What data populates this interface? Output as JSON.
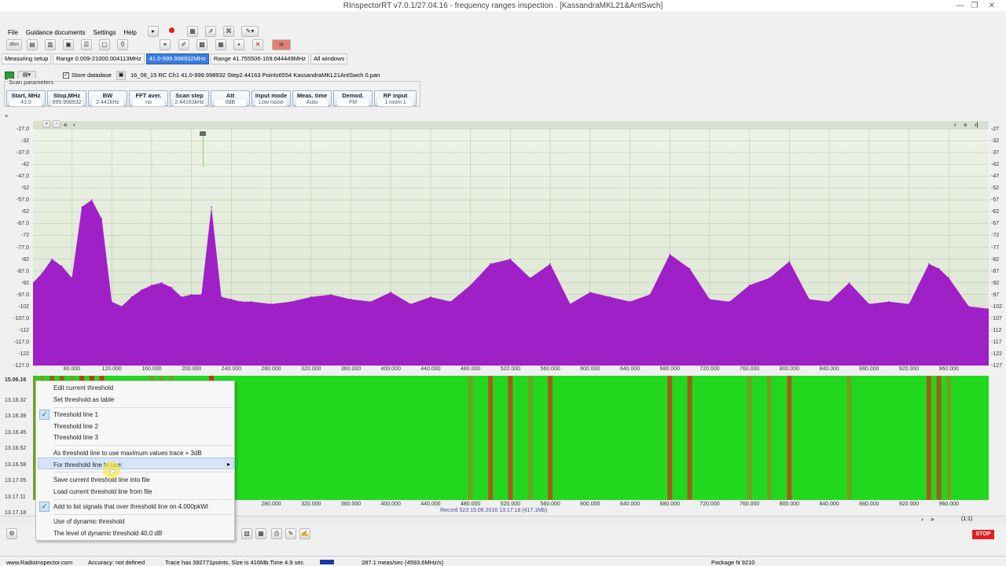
{
  "window": {
    "title": "RInspectorRT v7.0.1/27.04.16 - frequency ranges inspection . [KassandraMKL21&AntSwch]",
    "controls": [
      "—",
      "❐",
      "✕"
    ]
  },
  "menu": [
    "File",
    "Guidance documents",
    "Settings",
    "Help"
  ],
  "toolbar": {
    "unit_label": "dBm"
  },
  "tabs": [
    {
      "label": "Measuring setup",
      "active": false
    },
    {
      "label": "Range 0.009-21000.004113MHz",
      "active": false
    },
    {
      "label": "41.0-999.998932MHz",
      "active": true
    },
    {
      "label": "Range 41.755506-169.644449MHz",
      "active": false
    },
    {
      "label": "All windows",
      "active": false
    }
  ],
  "file": {
    "store_label": "Store datadase",
    "store_checked": true,
    "path": "16_06_15 RC  Ch1 41.0-999.998932 Step2.44163 Points6554 KassandraMKL21AntSwch 0.pan"
  },
  "scan": {
    "group_label": "Scan parameters",
    "params": [
      {
        "label": "Start, MHz",
        "value": "41.0"
      },
      {
        "label": "Stop,MHz",
        "value": "999.998932"
      },
      {
        "label": "BW",
        "value": "2.441kHz"
      },
      {
        "label": "FFT aver.",
        "value": "no"
      },
      {
        "label": "Scan step",
        "value": "2.44163kHz"
      },
      {
        "label": "Att",
        "value": "0dB"
      },
      {
        "label": "Input mode",
        "value": "Low noise"
      },
      {
        "label": "Meas. time",
        "value": "Auto"
      },
      {
        "label": "Demod.",
        "value": "FM"
      },
      {
        "label": "RF input",
        "value": "1 room 1"
      }
    ]
  },
  "spectrum": {
    "y_ticks": [
      "-27.0",
      "-32",
      "-37.0",
      "-42",
      "-47.0",
      "-52",
      "-57.0",
      "-62",
      "-67.0",
      "-72",
      "-77.0",
      "-82",
      "-87.0",
      "-92",
      "-97.0",
      "-102",
      "-107.0",
      "-112",
      "-117.0",
      "-122",
      "-127.0"
    ],
    "y_ticks_right": [
      "-27",
      "-32",
      "-37",
      "-42",
      "-47",
      "-52",
      "-57",
      "-62",
      "-67",
      "-72",
      "-77",
      "-82",
      "-87",
      "-92",
      "-97",
      "-102",
      "-107",
      "-112",
      "-117",
      "-122",
      "-127"
    ],
    "x_ticks": [
      "80.000",
      "120.000",
      "160.000",
      "200.000",
      "240.000",
      "280.000",
      "320.000",
      "360.000",
      "400.000",
      "440.000",
      "480.000",
      "520.000",
      "560.000",
      "600.000",
      "640.000",
      "680.000",
      "720.000",
      "760.000",
      "800.000",
      "840.000",
      "880.000",
      "920.000",
      "960.000"
    ],
    "trace_color": "#a020c8"
  },
  "chart_data": {
    "type": "area",
    "title": "",
    "xlabel": "",
    "ylabel": "",
    "xlim": [
      41.0,
      999.998932
    ],
    "ylim": [
      -127.0,
      -27.0
    ],
    "grid": true,
    "x": [
      41,
      50,
      60,
      70,
      80,
      90,
      100,
      110,
      120,
      130,
      140,
      150,
      160,
      170,
      180,
      190,
      200,
      210,
      220,
      230,
      240,
      250,
      260,
      280,
      300,
      320,
      340,
      360,
      380,
      400,
      420,
      440,
      460,
      480,
      500,
      520,
      540,
      560,
      580,
      600,
      620,
      640,
      660,
      680,
      700,
      720,
      740,
      760,
      780,
      800,
      820,
      840,
      860,
      880,
      900,
      920,
      940,
      950,
      960,
      980,
      1000
    ],
    "series": [
      {
        "values": [
          -92,
          -88,
          -82,
          -85,
          -90,
          -60,
          -57,
          -65,
          -100,
          -102,
          -98,
          -95,
          -93,
          -92,
          -94,
          -98,
          -97,
          -97,
          -60,
          -98,
          -99,
          -100,
          -100,
          -101,
          -100,
          -98,
          -97,
          -99,
          -100,
          -96,
          -101,
          -98,
          -100,
          -93,
          -84,
          -82,
          -90,
          -84,
          -101,
          -96,
          -98,
          -100,
          -97,
          -80,
          -86,
          -99,
          -100,
          -93,
          -90,
          -83,
          -99,
          -100,
          -92,
          -101,
          -100,
          -101,
          -84,
          -86,
          -90,
          -102,
          -103
        ]
      }
    ]
  },
  "waterfall": {
    "times": [
      "15.06.16",
      "13.16.32",
      "13.16.39",
      "13.16.45",
      "13.16.52",
      "13.16.58",
      "13.17.05",
      "13.17.11",
      "13.17.18"
    ],
    "x_ticks": [
      "280.000",
      "320.000",
      "360.000",
      "400.000",
      "440.000",
      "480.000",
      "520.000",
      "560.000",
      "600.000",
      "640.000",
      "680.000",
      "720.000",
      "760.000",
      "800.000",
      "840.000",
      "880.000",
      "920.000",
      "960.000"
    ],
    "record_text": "Record 523 15.06.2016 13:17:18 (417.1Mb)",
    "zoom_text": "(1:1)"
  },
  "context_menu": {
    "items": [
      {
        "label": "Edit current threshold",
        "checked": false
      },
      {
        "label": "Set threshold as table",
        "checked": false
      },
      {
        "label": "Threshold line 1",
        "checked": true
      },
      {
        "label": "Threshold line 2",
        "checked": false
      },
      {
        "label": "Threshold line 3",
        "checked": false
      },
      {
        "label": "As threshold line to use maximum values trace + 3dB",
        "checked": false
      },
      {
        "label": "For threshold line to use:",
        "checked": false,
        "submenu": true
      },
      {
        "label": "Save current threshold line into file",
        "checked": false
      },
      {
        "label": "Load current threshold line from file",
        "checked": false
      },
      {
        "label": "Add to list signals that over threshold line on 4.000pkWt",
        "checked": true
      },
      {
        "label": "Use of dynamic threshold",
        "checked": false
      },
      {
        "label": "The level of dynamic threshold 40.0 dB",
        "checked": false
      }
    ]
  },
  "stop_label": "STOP",
  "status": {
    "site": "www.RadioInspector.com",
    "accuracy": "Accuracy: not defined",
    "trace": "Trace has 392771points. Size is 416Mb.Time 4.9 sec",
    "rate": "287.1 meas/sec (4593.6MHz/s)",
    "package": "Package N 9210"
  }
}
